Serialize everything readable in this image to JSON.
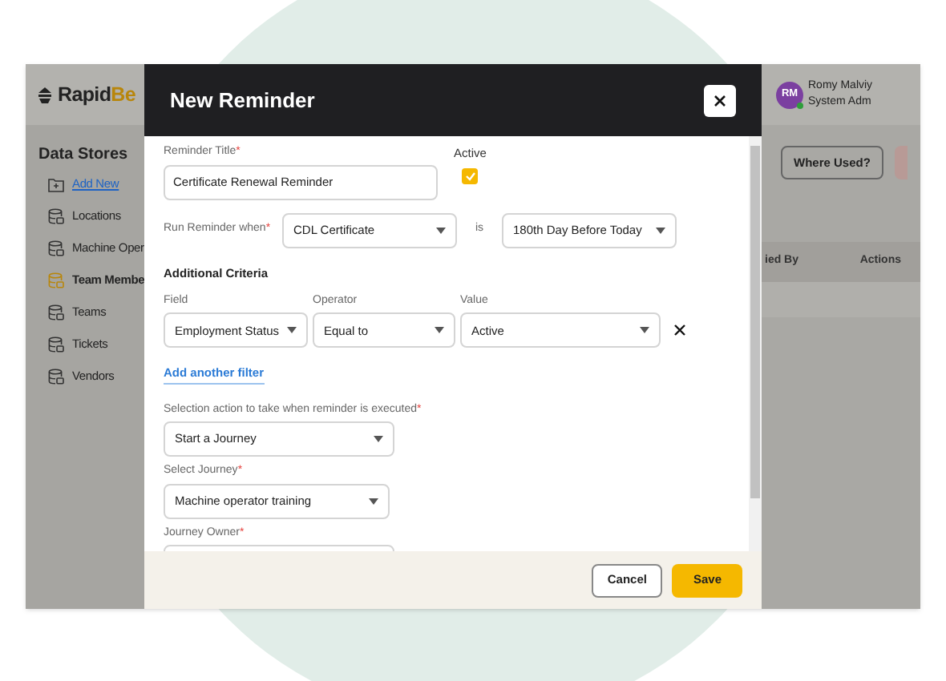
{
  "app": {
    "logo": {
      "part1": "Rapid",
      "part2": "Be"
    },
    "sidebar": {
      "title": "Data Stores",
      "items": [
        {
          "label": "Add New",
          "kind": "add",
          "selected": false
        },
        {
          "label": "Locations",
          "kind": "store",
          "selected": false
        },
        {
          "label": "Machine Oper",
          "kind": "store",
          "selected": false
        },
        {
          "label": "Team Membe",
          "kind": "store",
          "selected": true
        },
        {
          "label": "Teams",
          "kind": "store",
          "selected": false
        },
        {
          "label": "Tickets",
          "kind": "store",
          "selected": false
        },
        {
          "label": "Vendors",
          "kind": "store",
          "selected": false
        }
      ]
    },
    "user": {
      "initials": "RM",
      "name": "Romy Malviy",
      "role": "System Adm",
      "online": true
    },
    "where_used": "Where Used?",
    "table_columns": [
      "ied By",
      "Actions"
    ]
  },
  "modal": {
    "title": "New Reminder",
    "required_mark": "*",
    "reminder_title": {
      "label": "Reminder Title",
      "required": true,
      "value": "Certificate Renewal Reminder"
    },
    "active": {
      "label": "Active",
      "checked": true
    },
    "run_when": {
      "label": "Run Reminder when",
      "required": true,
      "subject": "CDL Certificate",
      "connector": "is",
      "condition": "180th Day Before Today"
    },
    "criteria": {
      "heading": "Additional Criteria",
      "columns": [
        "Field",
        "Operator",
        "Value"
      ],
      "rows": [
        {
          "field": "Employment Status",
          "operator": "Equal to",
          "value": "Active"
        }
      ],
      "add_link": "Add another filter"
    },
    "action": {
      "label": "Selection action to take when reminder is executed",
      "required": true,
      "value": "Start a Journey"
    },
    "journey": {
      "label": "Select Journey",
      "required": true,
      "value": "Machine operator training"
    },
    "owner": {
      "label": "Journey Owner",
      "required": true
    },
    "buttons": {
      "cancel": "Cancel",
      "save": "Save"
    }
  }
}
